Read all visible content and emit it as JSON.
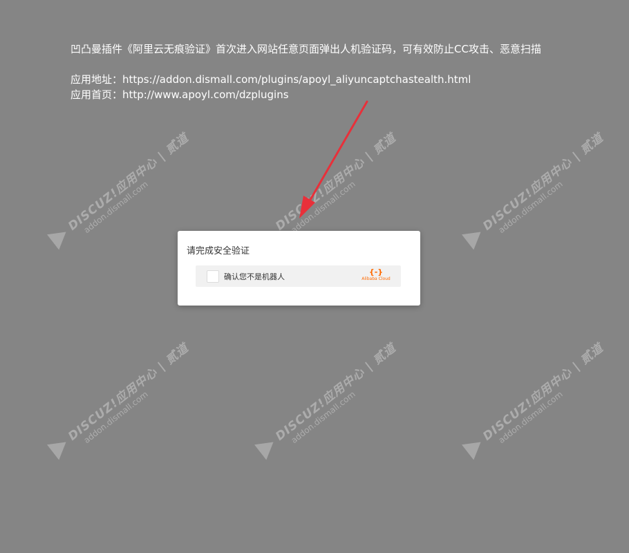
{
  "description": "凹凸曼插件《阿里云无痕验证》首次进入网站任意页面弹出人机验证码，可有效防止CC攻击、恶意扫描",
  "app_url_line": "应用地址：https://addon.dismall.com/plugins/apoyl_aliyuncaptchastealth.html",
  "home_url_line": "应用首页：http://www.apoyl.com/dzplugins",
  "watermark": {
    "line1": "DISCUZ!应用中心 | 贰道",
    "line2": "addon.dismall.com"
  },
  "dialog": {
    "title": "请完成安全验证",
    "checkbox_label": "确认您不是机器人",
    "brand_icon": "{-}",
    "brand_name": "Alibaba Cloud"
  },
  "colors": {
    "background": "#858585",
    "arrow": "#e8303a",
    "brand": "#ff6a00"
  }
}
